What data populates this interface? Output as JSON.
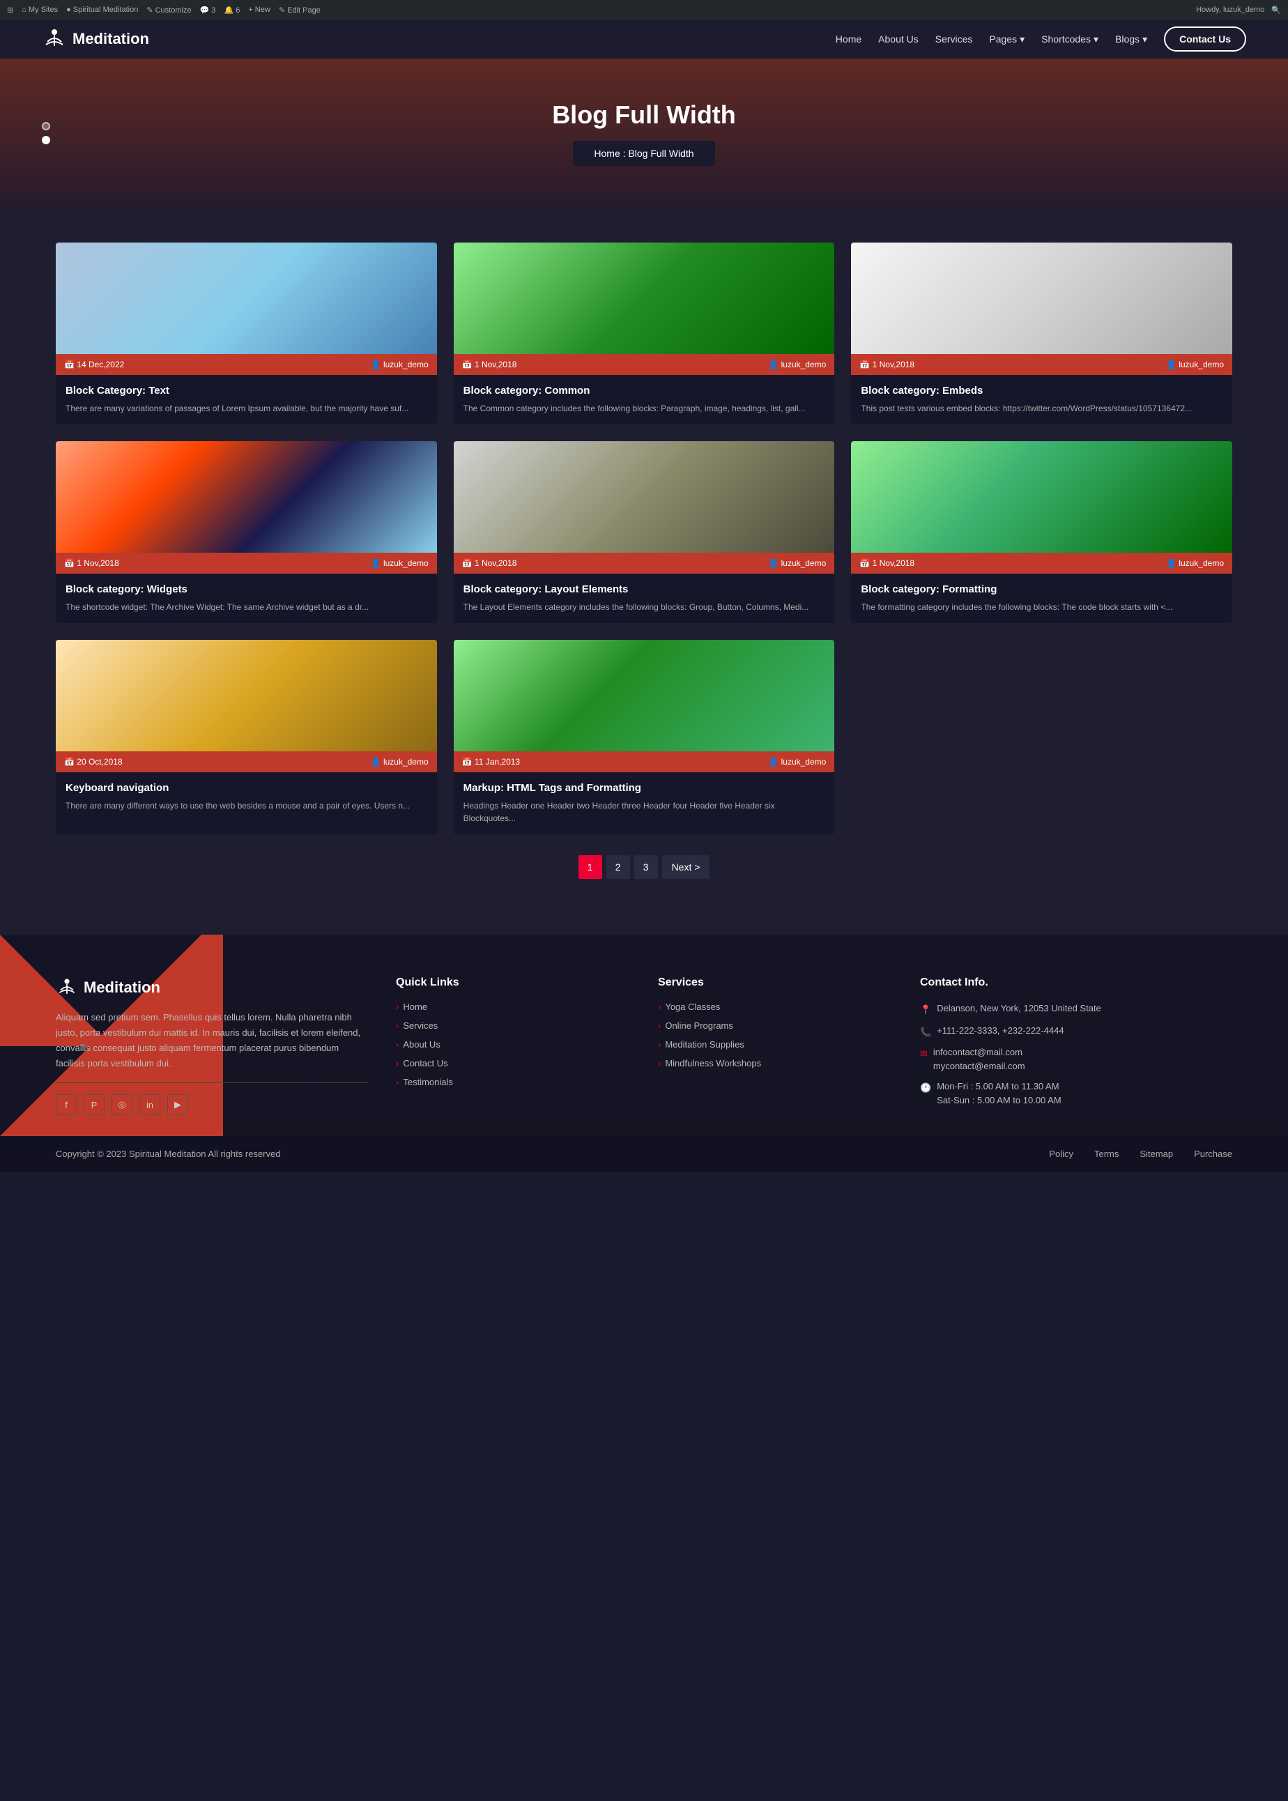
{
  "adminBar": {
    "items": [
      "WordPress logo",
      "My Sites",
      "Spiritual Meditation",
      "Customize",
      "3",
      "6",
      "New",
      "Edit Page"
    ],
    "right": "Howdy, luzuk_demo"
  },
  "header": {
    "logo": "Meditation",
    "nav": {
      "home": "Home",
      "about": "About Us",
      "services": "Services",
      "pages": "Pages",
      "shortcodes": "Shortcodes",
      "blogs": "Blogs",
      "contactBtn": "Contact Us"
    }
  },
  "hero": {
    "title": "Blog Full Width",
    "breadcrumb": "Home  :  Blog Full Width"
  },
  "blogCards": [
    {
      "date": "14 Dec,2022",
      "author": "luzuk_demo",
      "title": "Block Category: Text",
      "excerpt": "There are many variations of passages of Lorem Ipsum available, but the majority have suf...",
      "imgClass": "img-ph-1"
    },
    {
      "date": "1 Nov,2018",
      "author": "luzuk_demo",
      "title": "Block category: Common",
      "excerpt": "The Common category includes the following blocks: Paragraph, image, headings, list, gall...",
      "imgClass": "img-ph-2"
    },
    {
      "date": "1 Nov,2018",
      "author": "luzuk_demo",
      "title": "Block category: Embeds",
      "excerpt": "This post tests various embed blocks: https://twitter.com/WordPress/status/1057136472...",
      "imgClass": "img-ph-3"
    },
    {
      "date": "1 Nov,2018",
      "author": "luzuk_demo",
      "title": "Block category: Widgets",
      "excerpt": "The shortcode widget: The Archive Widget: The same Archive widget but as a dr...",
      "imgClass": "img-ph-4"
    },
    {
      "date": "1 Nov,2018",
      "author": "luzuk_demo",
      "title": "Block category: Layout Elements",
      "excerpt": "The Layout Elements category includes the following blocks: Group, Button, Columns, Medi...",
      "imgClass": "img-ph-5"
    },
    {
      "date": "1 Nov,2018",
      "author": "luzuk_demo",
      "title": "Block category: Formatting",
      "excerpt": "The formatting category includes the following blocks: The code block starts with <...",
      "imgClass": "img-ph-6"
    },
    {
      "date": "20 Oct,2018",
      "author": "luzuk_demo",
      "title": "Keyboard navigation",
      "excerpt": "There are many different ways to use the web besides a mouse and a pair of eyes. Users n...",
      "imgClass": "img-ph-7"
    },
    {
      "date": "11 Jan,2013",
      "author": "luzuk_demo",
      "title": "Markup: HTML Tags and Formatting",
      "excerpt": "Headings Header one Header two Header three Header four Header five Header six Blockquotes...",
      "imgClass": "img-ph-8"
    }
  ],
  "pagination": {
    "pages": [
      "1",
      "2",
      "3"
    ],
    "next": "Next >"
  },
  "footer": {
    "brand": {
      "logo": "Meditation",
      "description": "Aliquam sed pretium sem. Phasellus quis tellus lorem. Nulla pharetra nibh justo, porta vestibulum dui mattis id. In mauris dui, facilisis et lorem eleifend, convallis consequat justo aliquam fermentum placerat purus bibendum facilisis porta vestibulum dui."
    },
    "quickLinks": {
      "title": "Quick Links",
      "items": [
        "Home",
        "Services",
        "About Us",
        "Contact Us",
        "Testimonials"
      ]
    },
    "services": {
      "title": "Services",
      "items": [
        "Yoga Classes",
        "Online Programs",
        "Meditation Supplies",
        "Mindfulness Workshops"
      ]
    },
    "contact": {
      "title": "Contact Info.",
      "address": "Delanson, New York, 12053 United State",
      "phone": "+111-222-3333, +232-222-4444",
      "email1": "infocontact@mail.com",
      "email2": "mycontact@email.com",
      "hours1": "Mon-Fri : 5.00 AM to 11.30 AM",
      "hours2": "Sat-Sun : 5.00 AM to 10.00 AM"
    }
  },
  "footerBottom": {
    "copyright": "Copyright © 2023 Spiritual Meditation All rights reserved",
    "links": [
      "Policy",
      "Terms",
      "Sitemap",
      "Purchase"
    ]
  }
}
